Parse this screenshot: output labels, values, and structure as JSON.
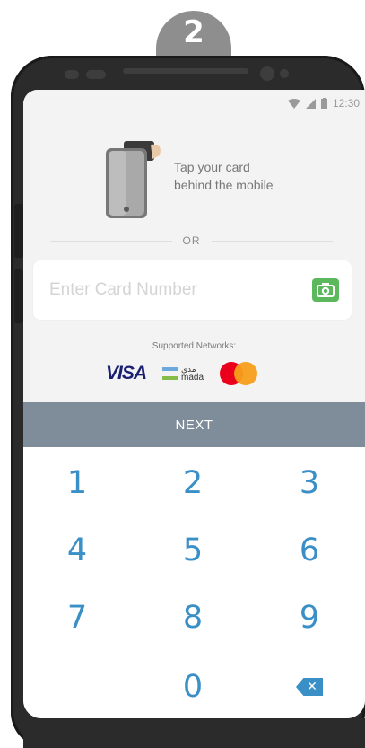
{
  "step": {
    "number": "2"
  },
  "status_bar": {
    "time": "12:30",
    "wifi_icon": "wifi-icon",
    "signal_icon": "signal-icon",
    "battery_icon": "battery-icon"
  },
  "tap": {
    "line1": "Tap your card",
    "line2": "behind the mobile"
  },
  "divider": {
    "label": "OR"
  },
  "card_input": {
    "placeholder": "Enter Card Number",
    "value": ""
  },
  "networks": {
    "title": "Supported Networks:",
    "visa": "VISA",
    "mada_ar": "مدى",
    "mada_en": "mada"
  },
  "next_button": {
    "label": "NEXT"
  },
  "keypad": {
    "keys": [
      "1",
      "2",
      "3",
      "4",
      "5",
      "6",
      "7",
      "8",
      "9",
      "0"
    ]
  },
  "colors": {
    "accent": "#3a8fc7",
    "next_bg": "#7f8c99",
    "camera_green": "#5cb85c"
  }
}
